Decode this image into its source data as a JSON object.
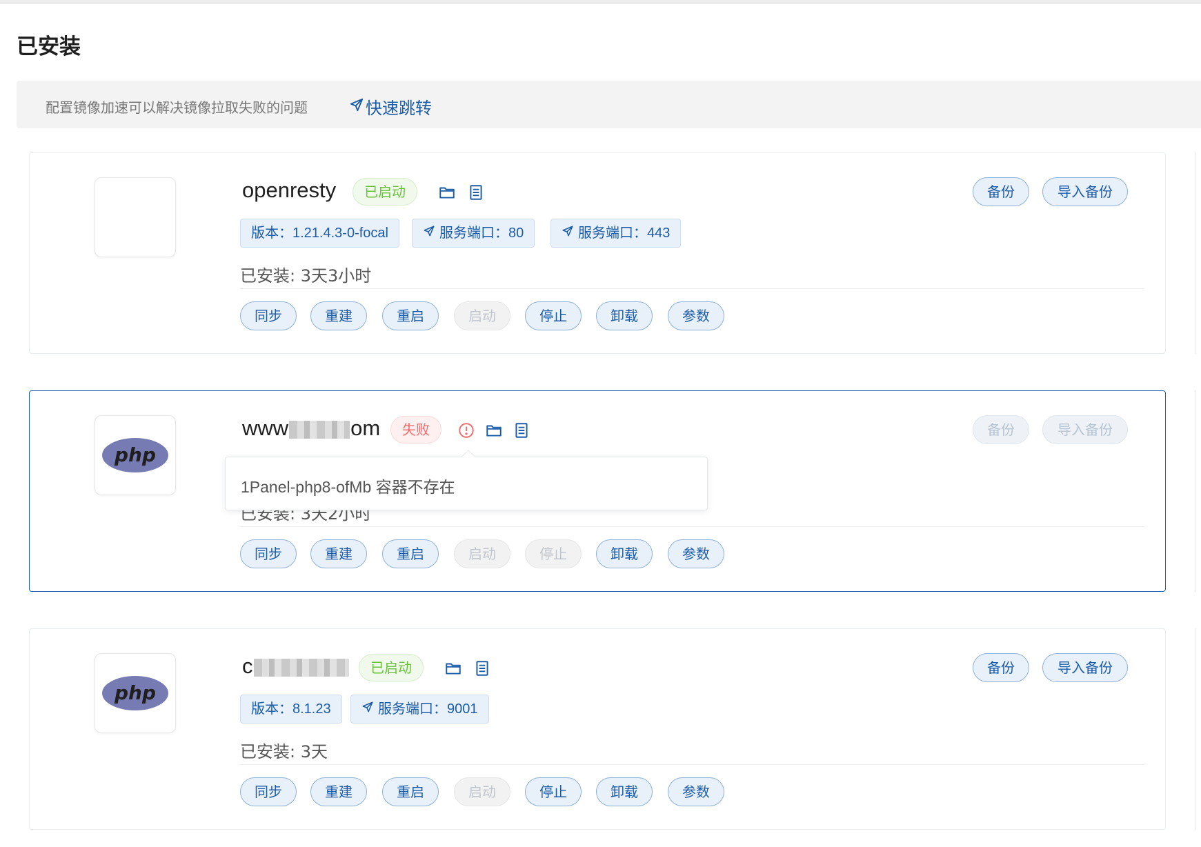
{
  "page": {
    "title": "已安装"
  },
  "notice": {
    "text": "配置镜像加速可以解决镜像拉取失败的问题",
    "link_label": "快速跳转"
  },
  "apps": [
    {
      "name": "openresty",
      "status": "已启动",
      "tags": [
        "版本：1.21.4.3-0-focal",
        "服务端口：80",
        "服务端口：443"
      ],
      "installed": "已安装:  3天3小时",
      "actions": [
        "同步",
        "重建",
        "重启",
        "启动",
        "停止",
        "卸载",
        "参数"
      ],
      "backup_label": "备份",
      "import_label": "导入备份"
    },
    {
      "name_start": "www",
      "name_end": "om",
      "status": "失败",
      "error": "1Panel-php8-ofMb 容器不存在",
      "installed": "已安装:  3天2小时",
      "actions": [
        "同步",
        "重建",
        "重启",
        "启动",
        "停止",
        "卸载",
        "参数"
      ],
      "backup_label": "备份",
      "import_label": "导入备份"
    },
    {
      "name_start": "c",
      "status": "已启动",
      "tags": [
        "版本：8.1.23",
        "服务端口：9001"
      ],
      "installed": "已安装:  3天",
      "actions": [
        "同步",
        "重建",
        "重启",
        "启动",
        "停止",
        "卸载",
        "参数"
      ],
      "backup_label": "备份",
      "import_label": "导入备份"
    }
  ],
  "colors": {
    "accent": "#1b5ca8",
    "success": "#67c23a",
    "danger": "#f56c6c"
  },
  "icons": [
    "send-icon",
    "folder-icon",
    "document-icon",
    "warning-icon",
    "php-logo"
  ]
}
